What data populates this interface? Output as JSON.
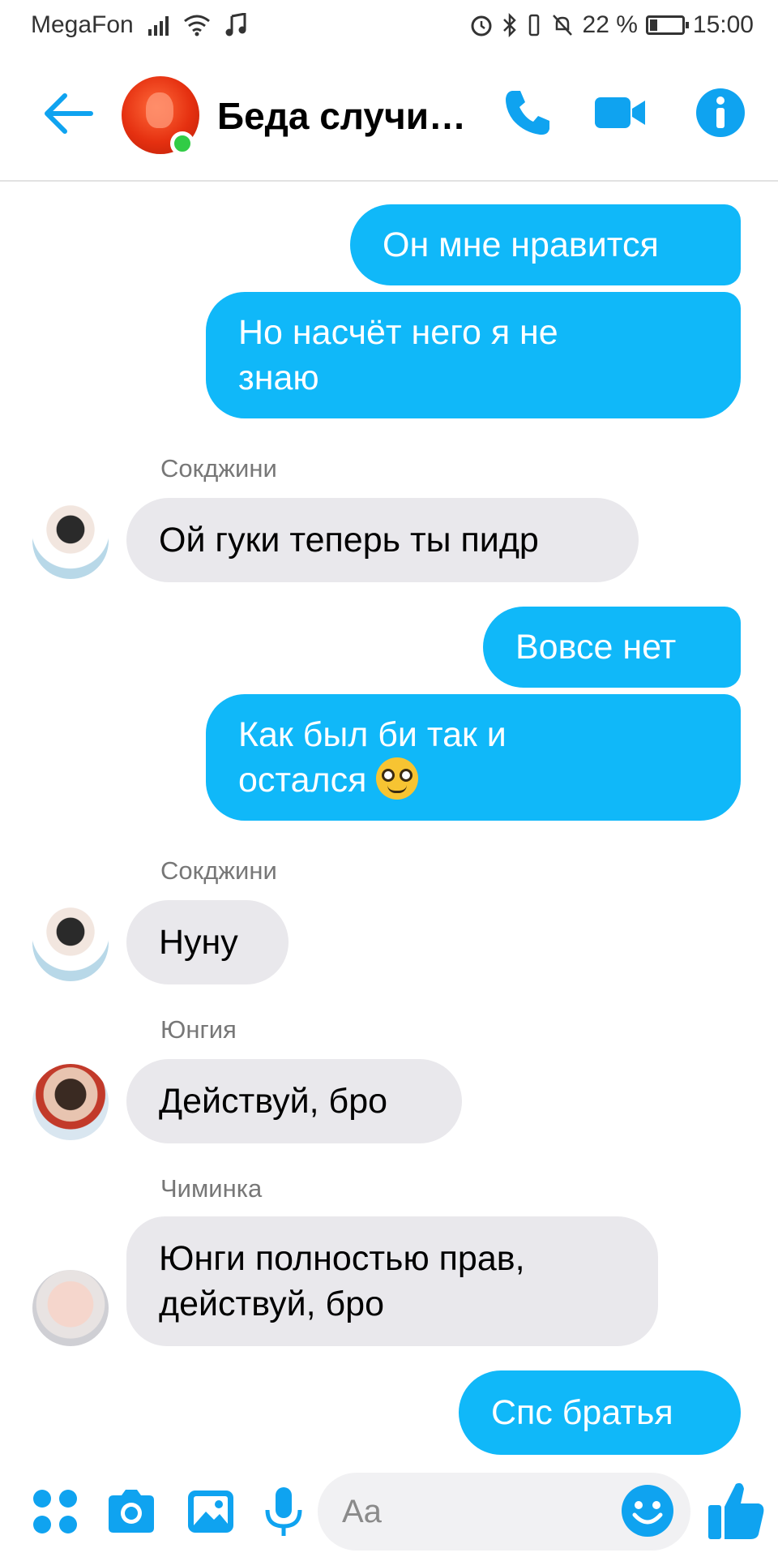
{
  "status_bar": {
    "carrier": "MegaFon",
    "battery_percent": "22 %",
    "battery_level": 0.22,
    "time": "15:00"
  },
  "header": {
    "title": "Беда случи…",
    "online": true
  },
  "messages": [
    {
      "dir": "out",
      "text": "Он мне нравится"
    },
    {
      "dir": "out",
      "lines": [
        "Но насчёт него я не",
        "знаю"
      ]
    },
    {
      "dir": "in",
      "sender": "Сокджини",
      "text": "Ой гуки теперь ты пидр"
    },
    {
      "dir": "out",
      "text": "Вовсе нет"
    },
    {
      "dir": "out",
      "lines": [
        "Как был би так и",
        "остался"
      ],
      "emoji": "nerd-face-emoji"
    },
    {
      "dir": "in",
      "sender": "Сокджини",
      "text": "Нуну"
    },
    {
      "dir": "in",
      "sender": "Юнгия",
      "text": "Действуй, бро"
    },
    {
      "dir": "in",
      "sender": "Чиминка",
      "lines": [
        "Юнги полностью прав,",
        "действуй, бро"
      ]
    },
    {
      "dir": "out",
      "text": "Спс братья"
    }
  ],
  "composer": {
    "placeholder": "Aa"
  },
  "colors": {
    "accent": "#0fa3f0",
    "outgoing_bubble": "#10b8f9",
    "incoming_bubble": "#e9e8ec",
    "online_dot": "#31cc46"
  }
}
